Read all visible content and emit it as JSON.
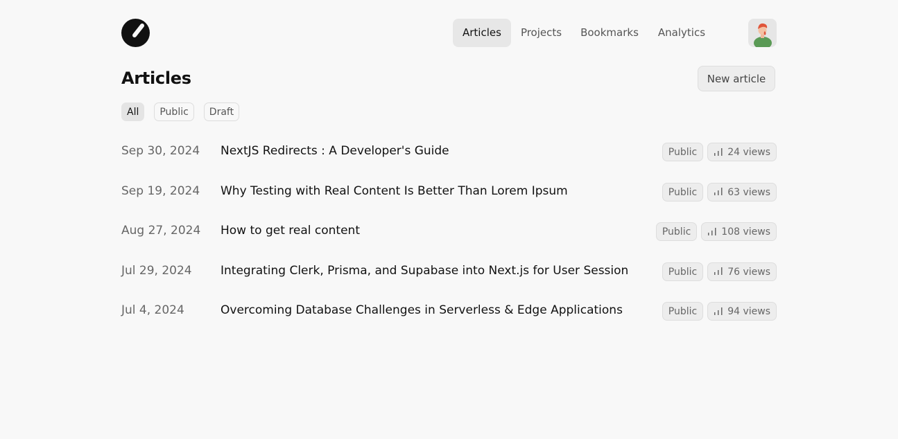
{
  "nav": {
    "items": [
      {
        "label": "Articles",
        "active": true
      },
      {
        "label": "Projects",
        "active": false
      },
      {
        "label": "Bookmarks",
        "active": false
      },
      {
        "label": "Analytics",
        "active": false
      }
    ],
    "logo_icon": "crescent-logo-icon",
    "avatar_icon": "user-avatar-illustration"
  },
  "page": {
    "title": "Articles",
    "new_button": "New article"
  },
  "filters": [
    "All",
    "Public",
    "Draft"
  ],
  "articles": [
    {
      "date": "Sep 30, 2024",
      "title": "NextJS Redirects : A Developer's Guide",
      "status": "Public",
      "views": "24 views"
    },
    {
      "date": "Sep 19, 2024",
      "title": "Why Testing with Real Content Is Better Than Lorem Ipsum",
      "status": "Public",
      "views": "63 views"
    },
    {
      "date": "Aug 27, 2024",
      "title": "How to get real content",
      "status": "Public",
      "views": "108 views"
    },
    {
      "date": "Jul 29, 2024",
      "title": "Integrating Clerk, Prisma, and Supabase into Next.js for User Session",
      "status": "Public",
      "views": "76 views"
    },
    {
      "date": "Jul 4, 2024",
      "title": "Overcoming Database Challenges in Serverless & Edge Applications",
      "status": "Public",
      "views": "94 views"
    }
  ],
  "colors": {
    "background": "#f8f8f8",
    "active_pill": "#e4e4e4",
    "text": "#111111",
    "muted": "#666666"
  }
}
